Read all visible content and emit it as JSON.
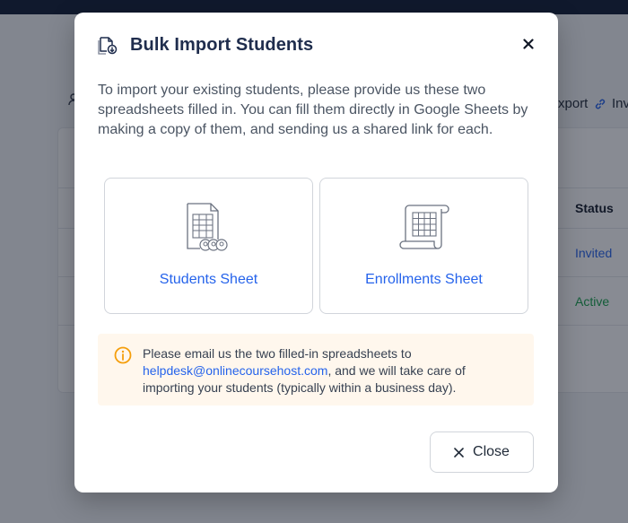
{
  "background": {
    "export_label": "Export",
    "invite_label": "Invite",
    "table": {
      "status_header": "Status",
      "rows": [
        {
          "status": "Invited"
        },
        {
          "status": "Active"
        }
      ]
    }
  },
  "modal": {
    "title": "Bulk Import Students",
    "title_icon": "file-import-icon",
    "close_icon": "close-icon",
    "intro": "To import your existing students, please provide us these two spreadsheets filled in. You can fill them directly in Google Sheets by making a copy of them, and sending us a shared link for each.",
    "sheets": [
      {
        "label": "Students Sheet",
        "icon": "students-sheet-icon"
      },
      {
        "label": "Enrollments Sheet",
        "icon": "enrollments-sheet-icon"
      }
    ],
    "info": {
      "icon": "info-icon",
      "text_before": "Please email us the two filled-in spreadsheets to ",
      "email": "helpdesk@onlinecoursehost.com",
      "text_after": ", and we will take care of importing your students (typically within a business day)."
    },
    "close_button_label": "Close"
  },
  "colors": {
    "accent": "#2563eb",
    "title": "#1f2d4d",
    "info_bg": "#fff7ed",
    "info_icon": "#f59e0b",
    "active_status": "#16a34a"
  }
}
